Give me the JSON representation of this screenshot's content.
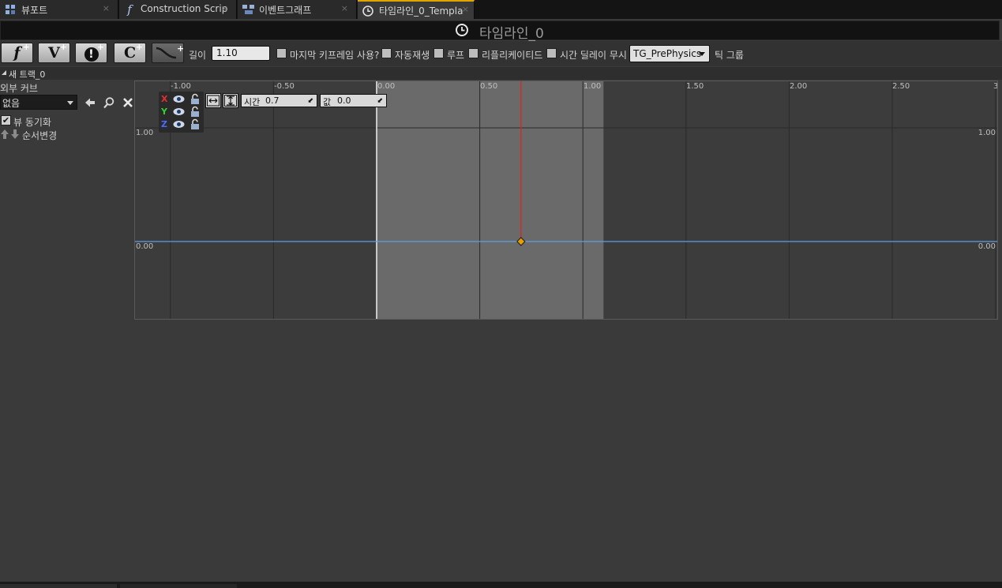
{
  "tabs": [
    {
      "label": "뷰포트",
      "icon": "viewport-grid-icon",
      "close": "×"
    },
    {
      "label": "Construction Scrip",
      "icon": "function-f-icon",
      "close": "×"
    },
    {
      "label": "이벤트그래프",
      "icon": "event-graph-icon",
      "close": "×"
    },
    {
      "label": "타임라인_0_Templa",
      "icon": "clock-icon",
      "close": "×"
    }
  ],
  "title": "타임라인_0",
  "toolbar": {
    "add_float_track": "f",
    "add_vector_track": "V",
    "add_event_track": "!",
    "add_color_track": "C",
    "plus": "+",
    "length_label": "길이",
    "length_value": "1.10",
    "use_last_keyframe_label": "마지막 키프레임 사용?",
    "autoplay_label": "자동재생",
    "loop_label": "루프",
    "replicated_label": "리플리케이티드",
    "ignore_time_dilation_label": "시간 딜레이 무시",
    "tick_group_value": "TG_PrePhysics",
    "tick_group_label": "틱 그룹"
  },
  "track": {
    "name": "새 트랙_0",
    "external_curve_label": "외부 커브",
    "external_curve_value": "없음",
    "sync_view_label": "뷰 동기화",
    "sync_view_checked": "✔",
    "reorder_label": "순서변경"
  },
  "graph": {
    "time_label": "시간",
    "time_value": "0.7",
    "value_label": "값",
    "value_value": "0.0",
    "axes": [
      "X",
      "Y",
      "Z"
    ],
    "axis_colors": [
      "#e03030",
      "#30d030",
      "#4a6aff"
    ],
    "ticks": [
      "-1.00",
      "-0.50",
      "0.00",
      "0.50",
      "1.00",
      "1.50",
      "2.00",
      "2.50",
      "3"
    ],
    "left_values": [
      "1.00",
      "0.00"
    ],
    "right_values": [
      "1.00",
      "0.00"
    ],
    "timeline_length": 1.1,
    "playhead_time": 0.7,
    "keys": [
      {
        "time": 0.7,
        "value": 0.0
      }
    ],
    "curve_color": "#5aa0e8",
    "playhead_color": "#e02020",
    "key_color": "#e8a000"
  }
}
